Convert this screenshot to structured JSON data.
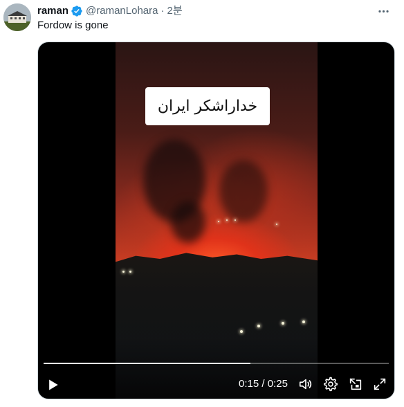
{
  "author": {
    "display_name": "raman",
    "handle": "@ramanLohara",
    "separator": "·",
    "timestamp": "2분",
    "verified": true
  },
  "tweet": {
    "text": "Fordow is gone"
  },
  "video": {
    "caption_overlay": "خداراشکر ایران",
    "current_time": "0:15",
    "time_separator": "/",
    "duration": "0:25",
    "progress": 0.6
  },
  "icons": {
    "more": "more-options-icon",
    "play": "play-icon",
    "volume": "volume-icon",
    "settings": "gear-icon",
    "pip": "picture-in-picture-icon",
    "fullscreen": "fullscreen-icon"
  },
  "colors": {
    "verified_badge": "#1d9bf0",
    "text_primary": "#0f1419",
    "text_secondary": "#536471"
  }
}
